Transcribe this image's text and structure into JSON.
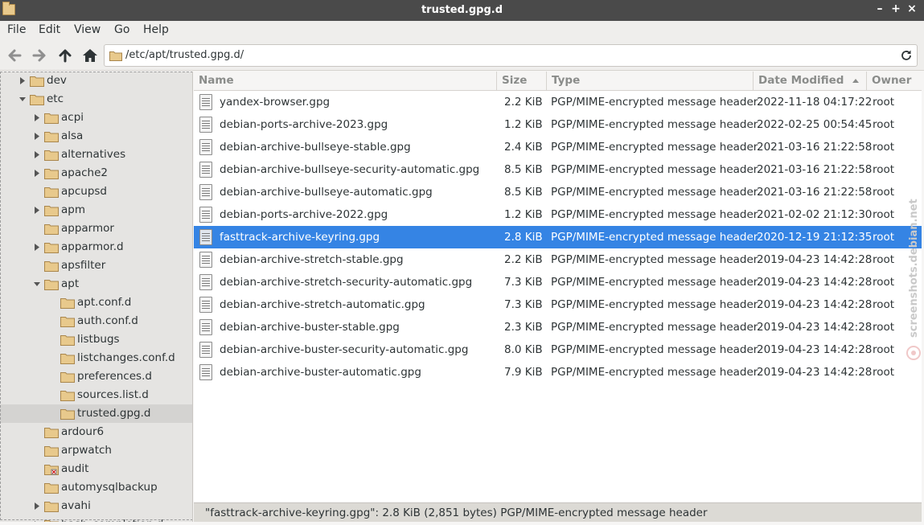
{
  "window": {
    "title": "trusted.gpg.d",
    "controls": [
      "–",
      "+",
      "×"
    ]
  },
  "menubar": [
    "File",
    "Edit",
    "View",
    "Go",
    "Help"
  ],
  "toolbar": {
    "location": "/etc/apt/trusted.gpg.d/"
  },
  "sidebar": {
    "items": [
      {
        "label": "dev",
        "expander": "collapsed",
        "level": 0
      },
      {
        "label": "etc",
        "expander": "expanded",
        "level": 0
      },
      {
        "label": "acpi",
        "expander": "collapsed",
        "level": 1
      },
      {
        "label": "alsa",
        "expander": "collapsed",
        "level": 1
      },
      {
        "label": "alternatives",
        "expander": "collapsed",
        "level": 1
      },
      {
        "label": "apache2",
        "expander": "collapsed",
        "level": 1
      },
      {
        "label": "apcupsd",
        "expander": "none",
        "level": 1
      },
      {
        "label": "apm",
        "expander": "collapsed",
        "level": 1
      },
      {
        "label": "apparmor",
        "expander": "none",
        "level": 1
      },
      {
        "label": "apparmor.d",
        "expander": "collapsed",
        "level": 1
      },
      {
        "label": "apsfilter",
        "expander": "none",
        "level": 1
      },
      {
        "label": "apt",
        "expander": "expanded",
        "level": 1
      },
      {
        "label": "apt.conf.d",
        "expander": "none",
        "level": 2
      },
      {
        "label": "auth.conf.d",
        "expander": "none",
        "level": 2
      },
      {
        "label": "listbugs",
        "expander": "none",
        "level": 2
      },
      {
        "label": "listchanges.conf.d",
        "expander": "none",
        "level": 2
      },
      {
        "label": "preferences.d",
        "expander": "none",
        "level": 2
      },
      {
        "label": "sources.list.d",
        "expander": "none",
        "level": 2
      },
      {
        "label": "trusted.gpg.d",
        "expander": "none",
        "level": 2,
        "selected": true
      },
      {
        "label": "ardour6",
        "expander": "none",
        "level": 1
      },
      {
        "label": "arpwatch",
        "expander": "none",
        "level": 1
      },
      {
        "label": "audit",
        "expander": "none",
        "level": 1,
        "locked": true
      },
      {
        "label": "automysqlbackup",
        "expander": "none",
        "level": 1
      },
      {
        "label": "avahi",
        "expander": "collapsed",
        "level": 1
      },
      {
        "label": "bash_completion.d",
        "expander": "collapsed",
        "level": 1
      }
    ]
  },
  "columns": {
    "name": "Name",
    "size": "Size",
    "type": "Type",
    "date": "Date Modified",
    "owner": "Owner"
  },
  "files": [
    {
      "name": "yandex-browser.gpg",
      "size": "2.2  KiB",
      "type": "PGP/MIME-encrypted message header",
      "date": "2022-11-18 04:17:22",
      "owner": "root"
    },
    {
      "name": "debian-ports-archive-2023.gpg",
      "size": "1.2  KiB",
      "type": "PGP/MIME-encrypted message header",
      "date": "2022-02-25 00:54:45",
      "owner": "root"
    },
    {
      "name": "debian-archive-bullseye-stable.gpg",
      "size": "2.4  KiB",
      "type": "PGP/MIME-encrypted message header",
      "date": "2021-03-16 21:22:58",
      "owner": "root"
    },
    {
      "name": "debian-archive-bullseye-security-automatic.gpg",
      "size": "8.5  KiB",
      "type": "PGP/MIME-encrypted message header",
      "date": "2021-03-16 21:22:58",
      "owner": "root"
    },
    {
      "name": "debian-archive-bullseye-automatic.gpg",
      "size": "8.5  KiB",
      "type": "PGP/MIME-encrypted message header",
      "date": "2021-03-16 21:22:58",
      "owner": "root"
    },
    {
      "name": "debian-ports-archive-2022.gpg",
      "size": "1.2  KiB",
      "type": "PGP/MIME-encrypted message header",
      "date": "2021-02-02 21:12:30",
      "owner": "root"
    },
    {
      "name": "fasttrack-archive-keyring.gpg",
      "size": "2.8  KiB",
      "type": "PGP/MIME-encrypted message header",
      "date": "2020-12-19 21:12:35",
      "owner": "root",
      "selected": true
    },
    {
      "name": "debian-archive-stretch-stable.gpg",
      "size": "2.2  KiB",
      "type": "PGP/MIME-encrypted message header",
      "date": "2019-04-23 14:42:28",
      "owner": "root"
    },
    {
      "name": "debian-archive-stretch-security-automatic.gpg",
      "size": "7.3  KiB",
      "type": "PGP/MIME-encrypted message header",
      "date": "2019-04-23 14:42:28",
      "owner": "root"
    },
    {
      "name": "debian-archive-stretch-automatic.gpg",
      "size": "7.3  KiB",
      "type": "PGP/MIME-encrypted message header",
      "date": "2019-04-23 14:42:28",
      "owner": "root"
    },
    {
      "name": "debian-archive-buster-stable.gpg",
      "size": "2.3  KiB",
      "type": "PGP/MIME-encrypted message header",
      "date": "2019-04-23 14:42:28",
      "owner": "root"
    },
    {
      "name": "debian-archive-buster-security-automatic.gpg",
      "size": "8.0  KiB",
      "type": "PGP/MIME-encrypted message header",
      "date": "2019-04-23 14:42:28",
      "owner": "root"
    },
    {
      "name": "debian-archive-buster-automatic.gpg",
      "size": "7.9  KiB",
      "type": "PGP/MIME-encrypted message header",
      "date": "2019-04-23 14:42:28",
      "owner": "root"
    }
  ],
  "status": "\"fasttrack-archive-keyring.gpg\": 2.8  KiB (2,851 bytes) PGP/MIME-encrypted message header",
  "watermark": "screenshots.debian.net",
  "colors": {
    "selection": "#3584e4",
    "titlebar": "#4a4a4a",
    "folder": "#e8c98c"
  }
}
